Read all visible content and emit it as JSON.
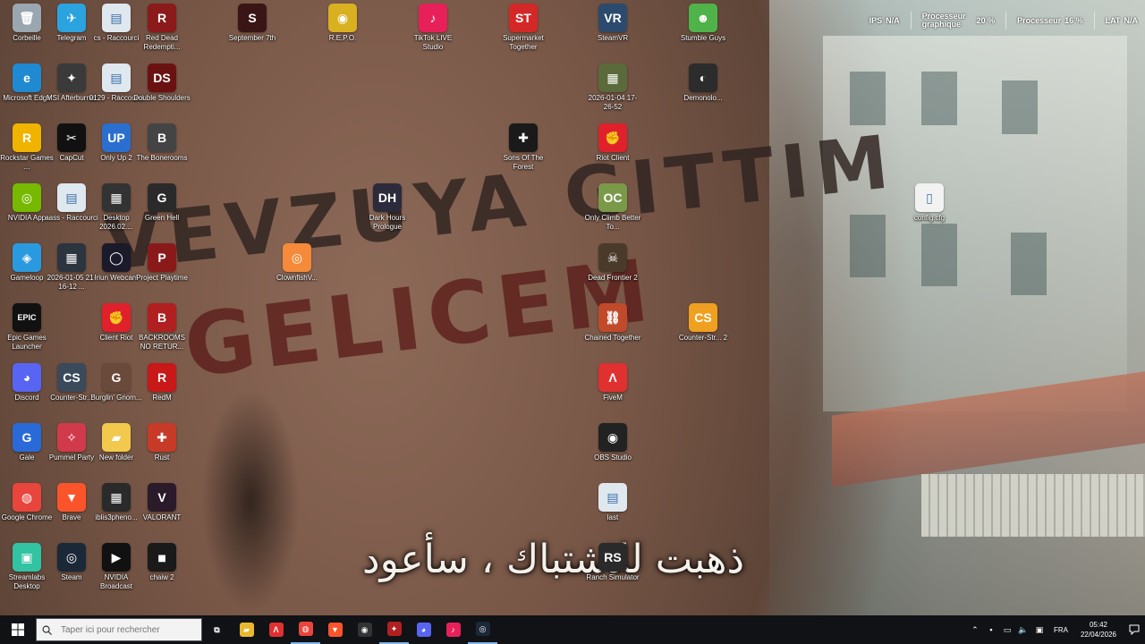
{
  "desktop": {
    "graffiti_line1": "VEVZUYA GITTIM",
    "graffiti_line2": "GELICEM",
    "subtitle": "ذهبت للاشتباك ، سأعود",
    "icons": [
      {
        "id": "corbeille",
        "label": "Corbeille",
        "icon": "recycle-bin-icon",
        "color": "#9aa6b0",
        "glyph": "🗑"
      },
      {
        "id": "telegram",
        "label": "Telegram",
        "icon": "telegram-icon",
        "color": "#2aa3df",
        "glyph": "✈"
      },
      {
        "id": "cs-raccourci",
        "label": "cs - Raccourci",
        "icon": "file-shortcut-icon",
        "color": "#dfe7ef",
        "glyph": "▤"
      },
      {
        "id": "red-dead",
        "label": "Red Dead Redempti...",
        "icon": "red-dead-icon",
        "color": "#8b1a1a",
        "glyph": "R"
      },
      {
        "id": "september-7th",
        "label": "September 7th",
        "icon": "game-icon",
        "color": "#3a1515",
        "glyph": "S"
      },
      {
        "id": "repo",
        "label": "R.E.P.O.",
        "icon": "repo-game-icon",
        "color": "#d8b020",
        "glyph": "◉"
      },
      {
        "id": "tiktok-live",
        "label": "TikTok LIVE Studio",
        "icon": "tiktok-icon",
        "color": "#e8205a",
        "glyph": "♪"
      },
      {
        "id": "supermarket",
        "label": "Supermarket Together",
        "icon": "supermarket-icon",
        "color": "#d42828",
        "glyph": "ST"
      },
      {
        "id": "steamvr",
        "label": "SteamVR",
        "icon": "steamvr-icon",
        "color": "#2b4a6e",
        "glyph": "VR"
      },
      {
        "id": "stumble",
        "label": "Stumble Guys",
        "icon": "stumble-guys-icon",
        "color": "#4fb34a",
        "glyph": "☻"
      },
      {
        "id": "edge",
        "label": "Microsoft Edge",
        "icon": "edge-icon",
        "color": "#1f8ad2",
        "glyph": "e"
      },
      {
        "id": "msi-afterburner",
        "label": "MSI Afterburner",
        "icon": "afterburner-icon",
        "color": "#3a3a3a",
        "glyph": "✦"
      },
      {
        "id": "raccourci-0129",
        "label": "0129 - Raccourci",
        "icon": "file-shortcut-icon",
        "color": "#dfe7ef",
        "glyph": "▤"
      },
      {
        "id": "double-shoulders",
        "label": "Double Shoulders",
        "icon": "double-shoulders-icon",
        "color": "#6a1212",
        "glyph": "DS"
      },
      {
        "id": "screenshot-2026-01-04",
        "label": "2026-01-04 17-26-52",
        "icon": "video-file-icon",
        "color": "#5a6a3a",
        "glyph": "▦"
      },
      {
        "id": "demonolo",
        "label": "Demonolo...",
        "icon": "demonologist-icon",
        "color": "#2c2c2c",
        "glyph": "◐"
      },
      {
        "id": "rockstar",
        "label": "Rockstar Games ...",
        "icon": "rockstar-icon",
        "color": "#f0b400",
        "glyph": "R"
      },
      {
        "id": "capcut",
        "label": "CapCut",
        "icon": "capcut-icon",
        "color": "#111111",
        "glyph": "✂"
      },
      {
        "id": "only-up-2",
        "label": "Only Up 2",
        "icon": "only-up-icon",
        "color": "#2a6fd0",
        "glyph": "UP"
      },
      {
        "id": "bonerooms",
        "label": "The Bonerooms",
        "icon": "bonerooms-icon",
        "color": "#444444",
        "glyph": "B"
      },
      {
        "id": "sons-of-forest",
        "label": "Sons Of The Forest",
        "icon": "sons-of-forest-icon",
        "color": "#1a1a1a",
        "glyph": "✚"
      },
      {
        "id": "riot-client",
        "label": "Riot Client",
        "icon": "riot-icon",
        "color": "#e0212c",
        "glyph": "✊"
      },
      {
        "id": "nvidia-app",
        "label": "NVIDIA App",
        "icon": "nvidia-icon",
        "color": "#76b900",
        "glyph": "◎"
      },
      {
        "id": "aass-raccourci",
        "label": "aass - Raccourci",
        "icon": "file-shortcut-icon",
        "color": "#dfe7ef",
        "glyph": "▤"
      },
      {
        "id": "desktop-2026",
        "label": "Desktop 2026.02....",
        "icon": "video-file-icon",
        "color": "#333333",
        "glyph": "▦"
      },
      {
        "id": "green-hell",
        "label": "Green Hell",
        "icon": "green-hell-icon",
        "color": "#2a2a2a",
        "glyph": "G"
      },
      {
        "id": "dark-hours",
        "label": "Dark Hours Prologue",
        "icon": "dark-hours-icon",
        "color": "#2b2b3b",
        "glyph": "DH"
      },
      {
        "id": "only-climb",
        "label": "Only Climb Better To...",
        "icon": "only-climb-icon",
        "color": "#7a9a4a",
        "glyph": "OC"
      },
      {
        "id": "config",
        "label": "config.cfg",
        "icon": "file-icon",
        "color": "#f2f2f2",
        "glyph": "▯"
      },
      {
        "id": "gameloop",
        "label": "Gameloop",
        "icon": "gameloop-icon",
        "color": "#2a9ae0",
        "glyph": "◈"
      },
      {
        "id": "video-2026-01-05",
        "label": "2026-01-05 21-16-12 ...",
        "icon": "video-file-icon",
        "color": "#2c3440",
        "glyph": "▦"
      },
      {
        "id": "iriun",
        "label": "Iriun Webcam",
        "icon": "webcam-icon",
        "color": "#1a1a2a",
        "glyph": "◯"
      },
      {
        "id": "project-playtime",
        "label": "Project Playtime",
        "icon": "project-playtime-icon",
        "color": "#8a1a1a",
        "glyph": "P"
      },
      {
        "id": "clownfish",
        "label": "ClownfishV...",
        "icon": "clownfish-icon",
        "color": "#f48a3a",
        "glyph": "◎"
      },
      {
        "id": "dead-frontier",
        "label": "Dead Frontier 2",
        "icon": "dead-frontier-icon",
        "color": "#4a3a2a",
        "glyph": "☠"
      },
      {
        "id": "epic",
        "label": "Epic Games Launcher",
        "icon": "epic-games-icon",
        "color": "#111111",
        "glyph": "EPIC"
      },
      {
        "id": "client-riot",
        "label": "Client Riot",
        "icon": "riot-icon",
        "color": "#e0212c",
        "glyph": "✊"
      },
      {
        "id": "backrooms",
        "label": "BACKROOMS NO RETUR...",
        "icon": "backrooms-icon",
        "color": "#b02020",
        "glyph": "B"
      },
      {
        "id": "chained-together",
        "label": "Chained Together",
        "icon": "chained-together-icon",
        "color": "#c04a2a",
        "glyph": "⛓"
      },
      {
        "id": "counter-strike-2",
        "label": "Counter-Str... 2",
        "icon": "counter-strike-icon",
        "color": "#f0a020",
        "glyph": "CS"
      },
      {
        "id": "discord",
        "label": "Discord",
        "icon": "discord-icon",
        "color": "#5865f2",
        "glyph": "◕"
      },
      {
        "id": "counter-strike",
        "label": "Counter-Str...",
        "icon": "counter-strike-icon",
        "color": "#3a4a5a",
        "glyph": "CS"
      },
      {
        "id": "burglin-gnomes",
        "label": "Burglin' Gnom...",
        "icon": "burglin-gnomes-icon",
        "color": "#6a4a3a",
        "glyph": "G"
      },
      {
        "id": "redm",
        "label": "RedM",
        "icon": "redm-icon",
        "color": "#c81818",
        "glyph": "R"
      },
      {
        "id": "fivem",
        "label": "FiveM",
        "icon": "fivem-icon",
        "color": "#e03030",
        "glyph": "Λ"
      },
      {
        "id": "gale",
        "label": "Gale",
        "icon": "gale-icon",
        "color": "#2a6ad8",
        "glyph": "G"
      },
      {
        "id": "pummel-party",
        "label": "Pummel Party",
        "icon": "pummel-party-icon",
        "color": "#d03a4a",
        "glyph": "✧"
      },
      {
        "id": "new-folder",
        "label": "New folder",
        "icon": "folder-icon",
        "color": "#f2c94c",
        "glyph": "▰"
      },
      {
        "id": "rust",
        "label": "Rust",
        "icon": "rust-icon",
        "color": "#c83a28",
        "glyph": "✚"
      },
      {
        "id": "obs",
        "label": "OBS Studio",
        "icon": "obs-icon",
        "color": "#222222",
        "glyph": "◉"
      },
      {
        "id": "chrome",
        "label": "Google Chrome",
        "icon": "chrome-icon",
        "color": "#e8453c",
        "glyph": "◍"
      },
      {
        "id": "brave",
        "label": "Brave",
        "icon": "brave-icon",
        "color": "#fb542b",
        "glyph": "▼"
      },
      {
        "id": "iblis",
        "label": "iblis3pheno...",
        "icon": "video-file-icon",
        "color": "#2a2a2a",
        "glyph": "▦"
      },
      {
        "id": "valorant",
        "label": "VALORANT",
        "icon": "valorant-icon",
        "color": "#2a1a2a",
        "glyph": "V"
      },
      {
        "id": "last",
        "label": "last",
        "icon": "file-shortcut-icon",
        "color": "#dfe7ef",
        "glyph": "▤"
      },
      {
        "id": "streamlabs",
        "label": "Streamlabs Desktop",
        "icon": "streamlabs-icon",
        "color": "#31c3a2",
        "glyph": "▣"
      },
      {
        "id": "steam",
        "label": "Steam",
        "icon": "steam-icon",
        "color": "#1b2838",
        "glyph": "◎"
      },
      {
        "id": "nvidia-broadcast",
        "label": "NVIDIA Broadcast",
        "icon": "nvidia-broadcast-icon",
        "color": "#111111",
        "glyph": "▶"
      },
      {
        "id": "chaiw2",
        "label": "chaiw 2",
        "icon": "file-icon",
        "color": "#1a1a1a",
        "glyph": "◾"
      },
      {
        "id": "ranch-simulator",
        "label": "Ranch Simulator",
        "icon": "ranch-simulator-icon",
        "color": "#2a2a2a",
        "glyph": "RS"
      }
    ]
  },
  "overlay": {
    "ips_label": "IPS",
    "ips_value": "N/A",
    "gpu_label_line1": "Processeur",
    "gpu_label_line2": "graphique",
    "gpu_value": "20 %",
    "cpu_label": "Processeur",
    "cpu_value": "16 %",
    "lat_label": "LAT",
    "lat_value": "N/A"
  },
  "taskbar": {
    "search_placeholder": "Taper ici pour rechercher",
    "apps": [
      {
        "name": "task-view-icon",
        "glyph": "⧉",
        "color": "transparent"
      },
      {
        "name": "file-explorer-icon",
        "glyph": "▰",
        "color": "#e8b830"
      },
      {
        "name": "fivem-icon",
        "glyph": "Λ",
        "color": "#e03030"
      },
      {
        "name": "chrome-icon",
        "glyph": "◍",
        "color": "#e8453c"
      },
      {
        "name": "brave-icon",
        "glyph": "▼",
        "color": "#fb542b"
      },
      {
        "name": "obs-icon",
        "glyph": "◉",
        "color": "#333333"
      },
      {
        "name": "msi-afterburner-icon",
        "glyph": "✦",
        "color": "#b02020"
      },
      {
        "name": "discord-icon",
        "glyph": "◕",
        "color": "#5865f2"
      },
      {
        "name": "tiktok-icon",
        "glyph": "♪",
        "color": "#e8205a"
      },
      {
        "name": "steam-icon",
        "glyph": "◎",
        "color": "#1b2838"
      }
    ],
    "tray": {
      "language": "FRA",
      "time": "05:42",
      "date": "22/04/2026"
    }
  }
}
